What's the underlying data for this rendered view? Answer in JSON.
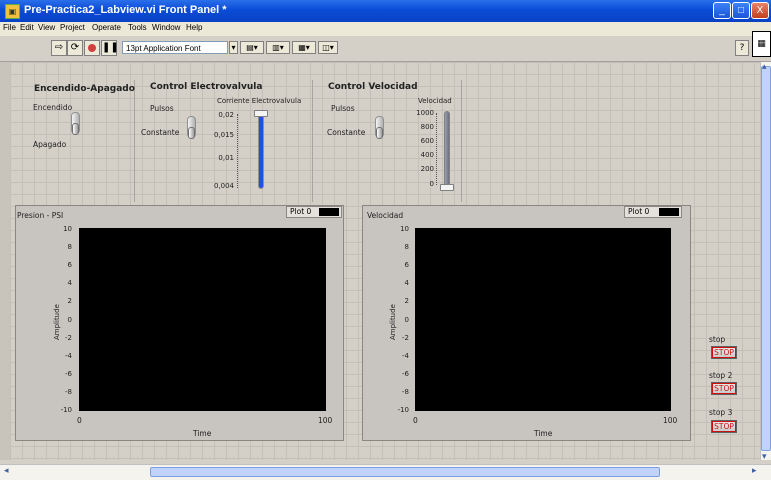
{
  "window": {
    "title": "Pre-Practica2_Labview.vi Front Panel *",
    "controls": {
      "minimize": "_",
      "maximize": "□",
      "close": "X"
    }
  },
  "menu": [
    "File",
    "Edit",
    "View",
    "Project",
    "Operate",
    "Tools",
    "Window",
    "Help"
  ],
  "toolbar": {
    "run_icon": "run-arrow-icon",
    "run_continuous_icon": "run-continuous-icon",
    "abort_icon": "abort-icon",
    "pause_icon": "pause-icon",
    "font": "13pt Application Font",
    "help": "?"
  },
  "panels": {
    "power": {
      "title": "Encendido-Apagado",
      "on_label": "Encendido",
      "off_label": "Apagado"
    },
    "valve": {
      "title": "Control Electrovalvula",
      "pulse_label": "Pulsos",
      "constant_label": "Constante",
      "slider_label": "Corriente Electrovalvula",
      "ticks": [
        "0,02",
        "0,015",
        "0,01",
        "0,004"
      ],
      "value_fraction": 1.0
    },
    "speed": {
      "title": "Control Velocidad",
      "pulse_label": "Pulsos",
      "constant_label": "Constante",
      "slider_label": "Velocidad",
      "ticks": [
        "1000",
        "800",
        "600",
        "400",
        "200",
        "0"
      ],
      "value_fraction": 0.0
    }
  },
  "graphs": [
    {
      "title": "Presion - PSI",
      "legend": "Plot 0",
      "y_axis_label": "Amplitude",
      "x_axis_label": "Time",
      "y_ticks": [
        "10",
        "8",
        "6",
        "4",
        "2",
        "0",
        "-2",
        "-4",
        "-6",
        "-8",
        "-10"
      ],
      "x_min": "0",
      "x_max": "100"
    },
    {
      "title": "Velocidad",
      "legend": "Plot 0",
      "y_axis_label": "Amplitude",
      "x_axis_label": "Time",
      "y_ticks": [
        "10",
        "8",
        "6",
        "4",
        "2",
        "0",
        "-2",
        "-4",
        "-6",
        "-8",
        "-10"
      ],
      "x_min": "0",
      "x_max": "100"
    }
  ],
  "stops": [
    {
      "label": "stop",
      "button": "STOP"
    },
    {
      "label": "stop 2",
      "button": "STOP"
    },
    {
      "label": "stop 3",
      "button": "STOP"
    }
  ],
  "colors": {
    "titlebar": "#0a4bd6",
    "slider_fill": "#2050e0",
    "stop_text": "#d01010",
    "plot_bg": "#000000"
  }
}
